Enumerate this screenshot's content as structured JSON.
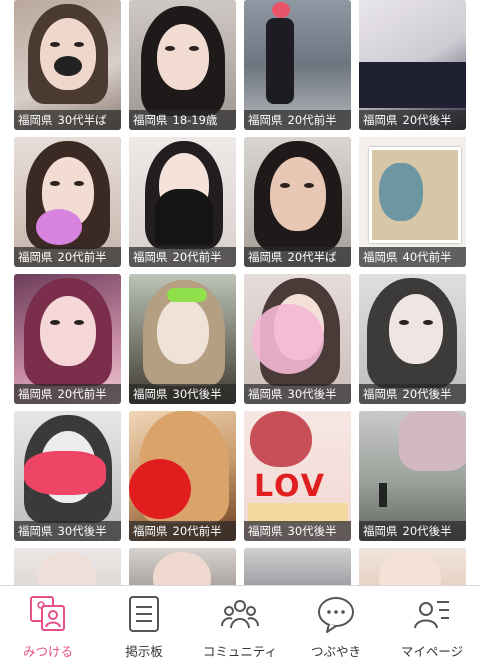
{
  "colors": {
    "accent": "#e4518a",
    "caption_bg": "#3a3a3a",
    "tab_text": "#333333"
  },
  "profiles": [
    {
      "location": "福岡県",
      "age": "30代半ば"
    },
    {
      "location": "福岡県",
      "age": "18-19歳"
    },
    {
      "location": "福岡県",
      "age": "20代前半"
    },
    {
      "location": "福岡県",
      "age": "20代後半"
    },
    {
      "location": "福岡県",
      "age": "20代前半"
    },
    {
      "location": "福岡県",
      "age": "20代前半"
    },
    {
      "location": "福岡県",
      "age": "20代半ば"
    },
    {
      "location": "福岡県",
      "age": "40代前半"
    },
    {
      "location": "福岡県",
      "age": "20代前半"
    },
    {
      "location": "福岡県",
      "age": "30代後半"
    },
    {
      "location": "福岡県",
      "age": "30代後半"
    },
    {
      "location": "福岡県",
      "age": "20代後半"
    },
    {
      "location": "福岡県",
      "age": "30代後半"
    },
    {
      "location": "福岡県",
      "age": "20代前半"
    },
    {
      "location": "福岡県",
      "age": "30代後半"
    },
    {
      "location": "福岡県",
      "age": "20代後半"
    }
  ],
  "photo_stickers": {
    "lov_text": "LOV"
  },
  "tabs": [
    {
      "label": "みつける",
      "icon": "find-users-icon",
      "active": true
    },
    {
      "label": "掲示板",
      "icon": "bulletin-board-icon",
      "active": false
    },
    {
      "label": "コミュニティ",
      "icon": "community-icon",
      "active": false
    },
    {
      "label": "つぶやき",
      "icon": "speech-bubble-icon",
      "active": false
    },
    {
      "label": "マイページ",
      "icon": "my-page-icon",
      "active": false
    }
  ]
}
